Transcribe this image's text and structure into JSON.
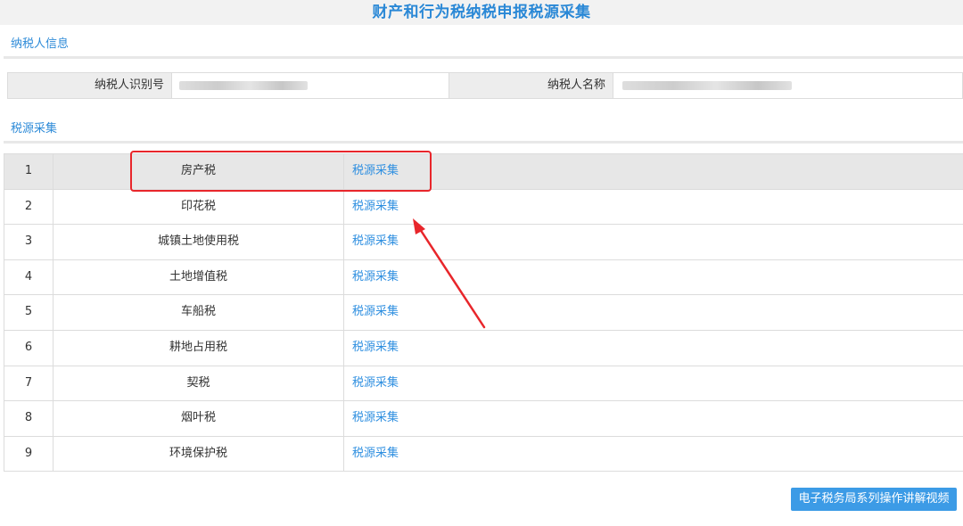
{
  "colors": {
    "accent": "#2e8bd8",
    "link": "#2f8fe0",
    "title": "#2a88d6",
    "annotation_red": "#e8262b",
    "button_bg": "#3c9be6"
  },
  "header": {
    "title": "财产和行为税纳税申报税源采集"
  },
  "taxpayer_section": {
    "tab_label": "纳税人信息",
    "id_label": "纳税人识别号",
    "id_value": "",
    "name_label": "纳税人名称",
    "name_value": ""
  },
  "source_section": {
    "tab_label": "税源采集"
  },
  "tax_rows": [
    {
      "index": "1",
      "name": "房产税",
      "action": "税源采集"
    },
    {
      "index": "2",
      "name": "印花税",
      "action": "税源采集"
    },
    {
      "index": "3",
      "name": "城镇土地使用税",
      "action": "税源采集"
    },
    {
      "index": "4",
      "name": "土地增值税",
      "action": "税源采集"
    },
    {
      "index": "5",
      "name": "车船税",
      "action": "税源采集"
    },
    {
      "index": "6",
      "name": "耕地占用税",
      "action": "税源采集"
    },
    {
      "index": "7",
      "name": "契税",
      "action": "税源采集"
    },
    {
      "index": "8",
      "name": "烟叶税",
      "action": "税源采集"
    },
    {
      "index": "9",
      "name": "环境保护税",
      "action": "税源采集"
    }
  ],
  "footer": {
    "video_button_label": "电子税务局系列操作讲解视频"
  }
}
